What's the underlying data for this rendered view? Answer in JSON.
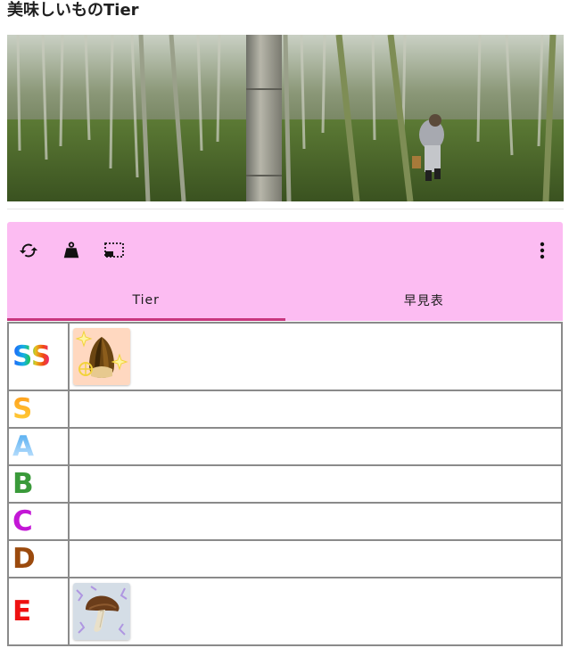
{
  "page": {
    "title": "美味しいものTier"
  },
  "toolbar": {
    "icons": [
      "refresh-icon",
      "weight-icon",
      "crop-select-icon",
      "more-vert-icon"
    ]
  },
  "tabs": [
    {
      "label": "Tier",
      "active": true
    },
    {
      "label": "早見表",
      "active": false
    }
  ],
  "tiers": [
    {
      "label": "SS",
      "color": "gradient",
      "items": [
        "bamboo-shoot-item"
      ]
    },
    {
      "label": "S",
      "color": "#f7b42c",
      "items": []
    },
    {
      "label": "A",
      "color": "#6fbbf5",
      "items": []
    },
    {
      "label": "B",
      "color": "#3a9a3a",
      "items": []
    },
    {
      "label": "C",
      "color": "#c317d6",
      "items": []
    },
    {
      "label": "D",
      "color": "#9b4a0d",
      "items": []
    },
    {
      "label": "E",
      "color": "#ee1111",
      "items": [
        "mushroom-item"
      ]
    }
  ],
  "colors": {
    "panel_bg": "#fcbcf2",
    "tab_indicator": "#c8367e",
    "grid_border": "#8a8a8a"
  }
}
